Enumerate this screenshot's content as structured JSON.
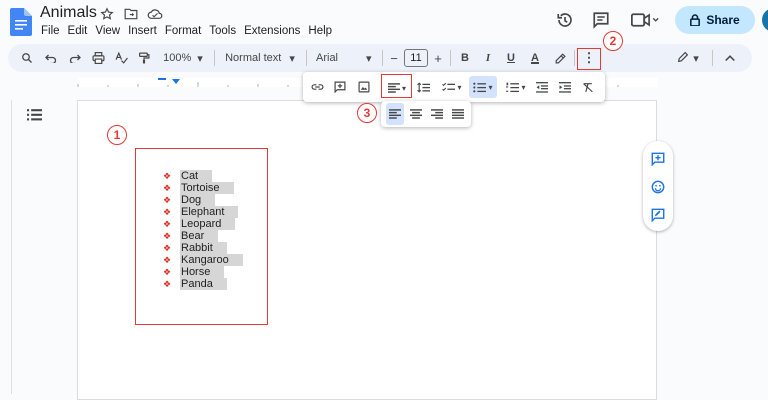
{
  "app": {
    "title": "Animals"
  },
  "menu": [
    "File",
    "Edit",
    "View",
    "Insert",
    "Format",
    "Tools",
    "Extensions",
    "Help"
  ],
  "header": {
    "share_label": "Share"
  },
  "toolbar": {
    "zoom": "100%",
    "style": "Normal text",
    "font": "Arial",
    "font_size": "11",
    "minus": "−",
    "plus": "+",
    "bold": "B",
    "italic": "I",
    "underline": "U",
    "text_color": "A"
  },
  "list_items": [
    "Cat",
    "Tortoise",
    "Dog",
    "Elephant",
    "Leopard",
    "Bear",
    "Rabbit",
    "Kangaroo",
    "Horse",
    "Panda"
  ],
  "annotations": {
    "one": "1",
    "two": "2",
    "three": "3"
  },
  "colors": {
    "accent": "#c2e7ff",
    "annotation": "#e53935",
    "bullet": "#d93025",
    "toolbar_bg": "#edf2fa"
  }
}
